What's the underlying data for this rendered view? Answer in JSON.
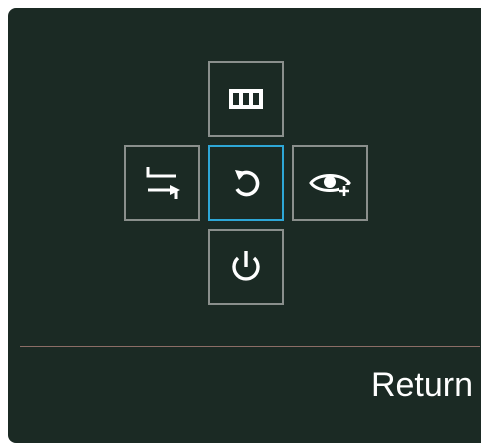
{
  "osd": {
    "keys": {
      "up": {
        "icon": "columns-icon"
      },
      "left": {
        "icon": "swap-arrows-icon"
      },
      "center": {
        "icon": "return-icon",
        "selected": true
      },
      "right": {
        "icon": "eye-plus-icon"
      },
      "down": {
        "icon": "power-icon"
      }
    },
    "status_label": "Return",
    "colors": {
      "panel_bg": "#1b2a24",
      "key_border": "#8a8f8c",
      "selected_border": "#2ea7d6",
      "divider": "#8b6d66",
      "text": "#ffffff"
    }
  }
}
